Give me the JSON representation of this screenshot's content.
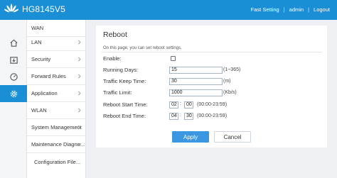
{
  "header": {
    "model": "HG8145V5",
    "fast_setting": "Fast Setting",
    "separator": "|",
    "user": "admin",
    "logout": "Logout"
  },
  "rail": {
    "icons": [
      "home-icon",
      "status-icon",
      "gauge-icon",
      "gear-icon"
    ]
  },
  "menu": {
    "items": [
      {
        "label": "WAN"
      },
      {
        "label": "LAN"
      },
      {
        "label": "Security"
      },
      {
        "label": "Forward Rules"
      },
      {
        "label": "Application"
      },
      {
        "label": "WLAN"
      },
      {
        "label": "System Management"
      },
      {
        "label": "Maintenance Diagno..."
      }
    ],
    "sub_item": "Configuration File..."
  },
  "page": {
    "title": "Reboot",
    "description": "On this page, you can set reboot settings.",
    "enable_label": "Enable:",
    "running_days_label": "Running Days:",
    "running_days_value": "15",
    "running_days_hint": "(1~365)",
    "traffic_keep_label": "Traffic Keep Time:",
    "traffic_keep_value": "30",
    "traffic_keep_hint": "(m)",
    "traffic_limit_label": "Traffic Limit:",
    "traffic_limit_value": "1000",
    "traffic_limit_hint": "(Kb/s)",
    "start_label": "Reboot Start Time:",
    "start_hour": "02",
    "start_min": "00",
    "start_hint": "(00:00-23:59)",
    "end_label": "Reboot End Time:",
    "end_hour": "04",
    "end_min": "30",
    "end_hint": "(00:00-23:59)",
    "colon": ":",
    "apply": "Apply",
    "cancel": "Cancel"
  },
  "colors": {
    "brand_blue": "#1a8fd6",
    "button_blue": "#3b98e0"
  }
}
